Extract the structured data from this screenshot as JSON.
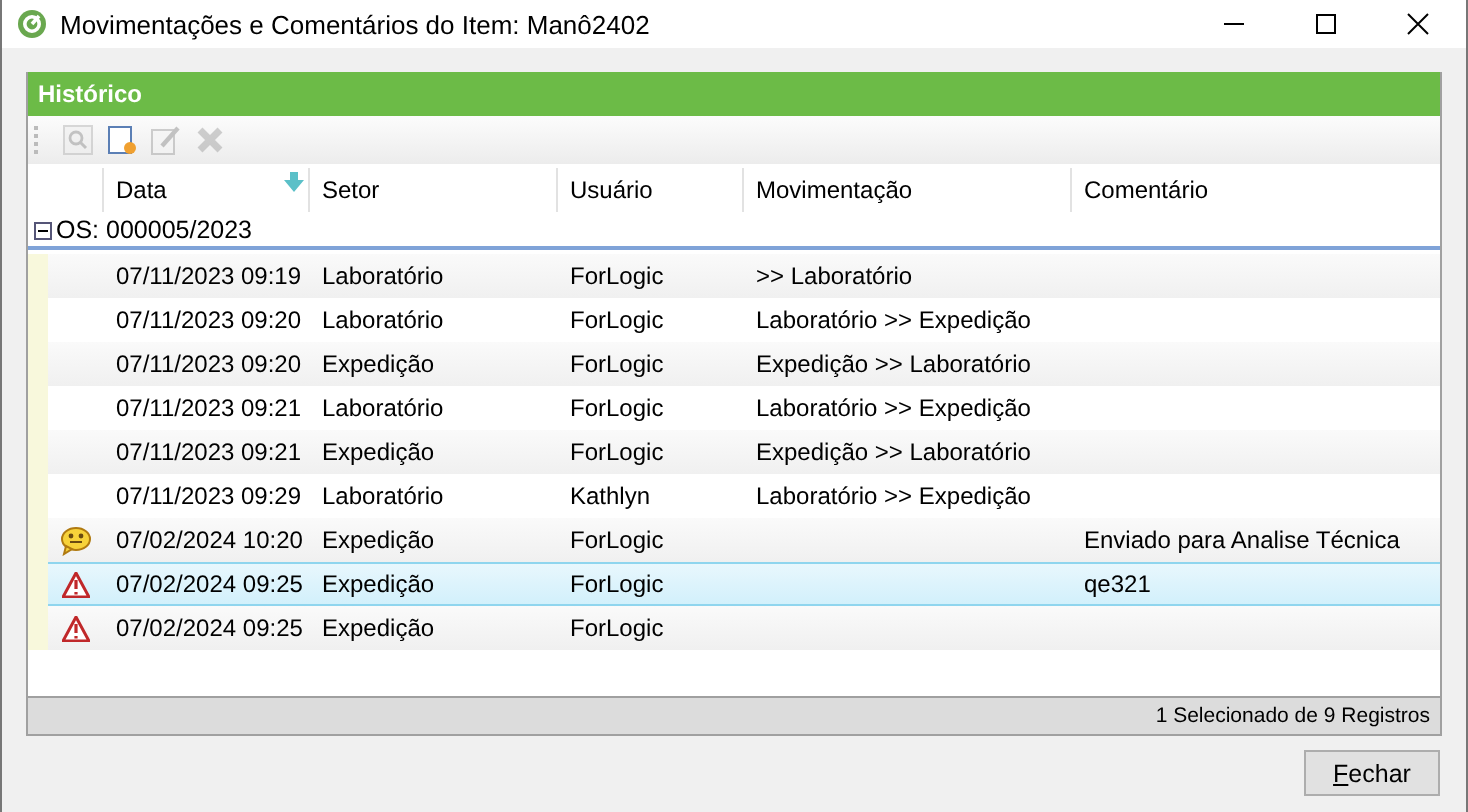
{
  "window": {
    "title": "Movimentações e Comentários do Item: Manô2402"
  },
  "panel": {
    "title": "Histórico"
  },
  "toolbar": [
    {
      "kind": "view",
      "disabled": true
    },
    {
      "kind": "new",
      "disabled": false
    },
    {
      "kind": "edit",
      "disabled": true
    },
    {
      "kind": "delete",
      "disabled": true
    }
  ],
  "table": {
    "columns": [
      {
        "label": "Data",
        "sorted": true
      },
      {
        "label": "Setor",
        "sorted": false
      },
      {
        "label": "Usuário",
        "sorted": false
      },
      {
        "label": "Movimentação",
        "sorted": false
      },
      {
        "label": "Comentário",
        "sorted": false
      }
    ],
    "group": {
      "label": "OS: 000005/2023",
      "expanded": true
    },
    "rows": [
      {
        "kind": "none",
        "selected": false,
        "cells": [
          "07/11/2023 09:19",
          "Laboratório",
          "ForLogic",
          ">> Laboratório",
          ""
        ]
      },
      {
        "kind": "none",
        "selected": false,
        "cells": [
          "07/11/2023 09:20",
          "Laboratório",
          "ForLogic",
          "Laboratório >> Expedição",
          ""
        ]
      },
      {
        "kind": "none",
        "selected": false,
        "cells": [
          "07/11/2023 09:20",
          "Expedição",
          "ForLogic",
          "Expedição >> Laboratório",
          ""
        ]
      },
      {
        "kind": "none",
        "selected": false,
        "cells": [
          "07/11/2023 09:21",
          "Laboratório",
          "ForLogic",
          "Laboratório >> Expedição",
          ""
        ]
      },
      {
        "kind": "none",
        "selected": false,
        "cells": [
          "07/11/2023 09:21",
          "Expedição",
          "ForLogic",
          "Expedição >> Laboratório",
          ""
        ]
      },
      {
        "kind": "none",
        "selected": false,
        "cells": [
          "07/11/2023 09:29",
          "Laboratório",
          "Kathlyn",
          "Laboratório >> Expedição",
          ""
        ]
      },
      {
        "kind": "comment",
        "selected": false,
        "cells": [
          "07/02/2024 10:20",
          "Expedição",
          "ForLogic",
          "",
          "Enviado para Analise Técnica"
        ]
      },
      {
        "kind": "warning",
        "selected": true,
        "cells": [
          "07/02/2024 09:25",
          "Expedição",
          "ForLogic",
          "",
          "qe321"
        ]
      },
      {
        "kind": "warning",
        "selected": false,
        "cells": [
          "07/02/2024 09:25",
          "Expedição",
          "ForLogic",
          "",
          ""
        ]
      }
    ]
  },
  "status_bar": "1 Selecionado de 9 Registros",
  "buttons": [
    {
      "label": "Fechar"
    }
  ]
}
